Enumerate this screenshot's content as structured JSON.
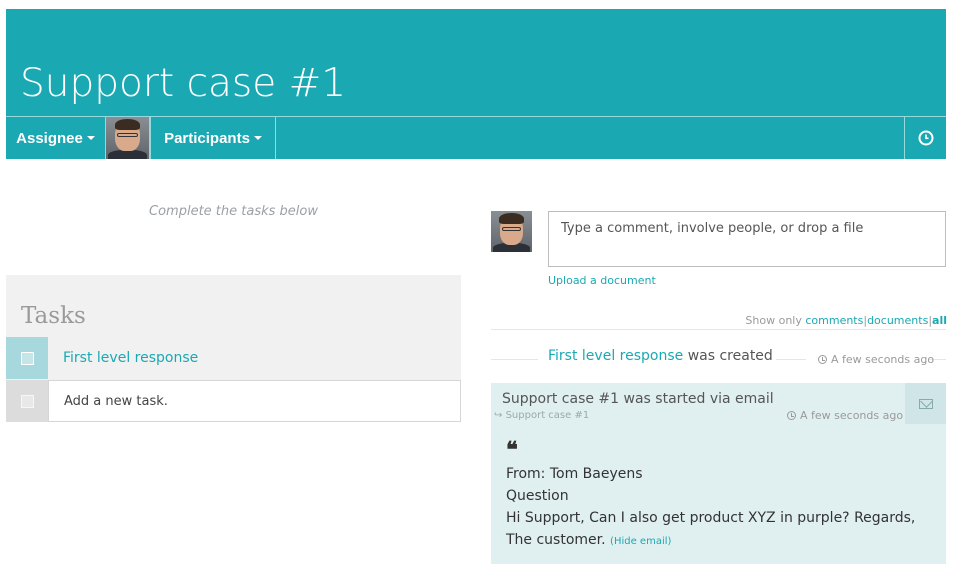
{
  "header": {
    "title": "Support case #1",
    "assignee_label": "Assignee",
    "participants_label": "Participants",
    "clock_icon": "clock-icon",
    "accent_color": "#1aa9b3"
  },
  "left": {
    "hint": "Complete the tasks below",
    "tasks_title": "Tasks",
    "tasks": [
      {
        "label": "First level response"
      }
    ],
    "new_task_placeholder": "Add a new task."
  },
  "right": {
    "comment_placeholder": "Type a comment, involve people, or drop a file",
    "upload_label": "Upload a document",
    "filter": {
      "prefix": "Show only",
      "comments": "comments",
      "documents": "documents",
      "all": "all",
      "sep": "|"
    },
    "event": {
      "link": "First level response",
      "text": "was created",
      "time": "A few seconds ago"
    },
    "email": {
      "title": "Support case #1 was started via email",
      "sub": "Support case #1",
      "time": "A few seconds ago",
      "from": "From: Tom Baeyens",
      "subject": "Question",
      "body": "Hi Support, Can I also get product XYZ in purple? Regards, The customer.",
      "hide_label": "(Hide email)"
    }
  }
}
